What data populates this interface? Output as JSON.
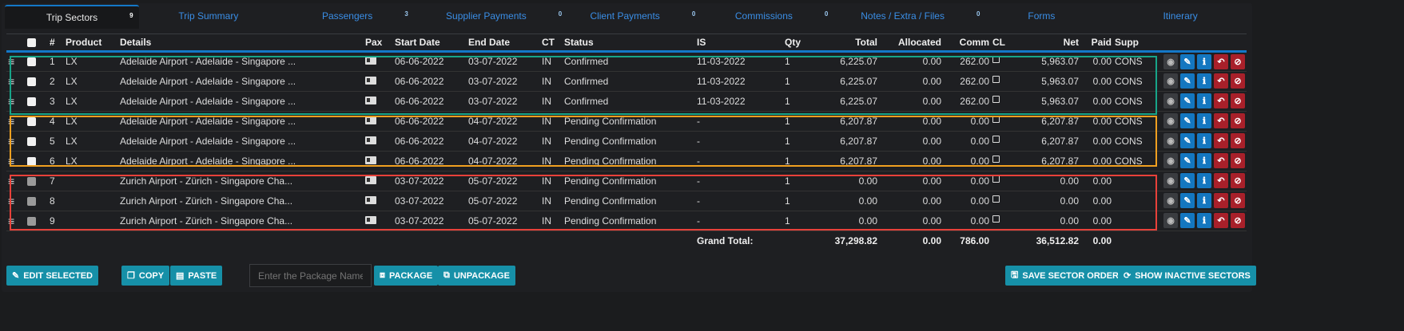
{
  "tabs": [
    {
      "label": "Trip Sectors",
      "count": "9",
      "active": true
    },
    {
      "label": "Trip Summary",
      "count": ""
    },
    {
      "label": "Passengers",
      "count": "3"
    },
    {
      "label": "Supplier Payments",
      "count": "0"
    },
    {
      "label": "Client Payments",
      "count": "0"
    },
    {
      "label": "Commissions",
      "count": "0"
    },
    {
      "label": "Notes / Extra / Files",
      "count": "0"
    },
    {
      "label": "Forms",
      "count": ""
    },
    {
      "label": "Itinerary",
      "count": ""
    }
  ],
  "columns": [
    "#",
    "Product",
    "Details",
    "Pax",
    "Start Date",
    "End Date",
    "CT",
    "Status",
    "IS",
    "Qty",
    "Total",
    "Allocated",
    "Comm",
    "CL",
    "Net",
    "Paid",
    "Supp"
  ],
  "rows": [
    {
      "n": "1",
      "product": "LX",
      "details": "Adelaide Airport - Adelaide - Singapore ...",
      "start": "06-06-2022",
      "end": "03-07-2022",
      "ct": "IN",
      "status": "Confirmed",
      "is": "11-03-2022",
      "qty": "1",
      "total": "6,225.07",
      "allocated": "0.00",
      "comm": "262.00",
      "net": "5,963.07",
      "paid": "0.00",
      "supp": "CONS"
    },
    {
      "n": "2",
      "product": "LX",
      "details": "Adelaide Airport - Adelaide - Singapore ...",
      "start": "06-06-2022",
      "end": "03-07-2022",
      "ct": "IN",
      "status": "Confirmed",
      "is": "11-03-2022",
      "qty": "1",
      "total": "6,225.07",
      "allocated": "0.00",
      "comm": "262.00",
      "net": "5,963.07",
      "paid": "0.00",
      "supp": "CONS"
    },
    {
      "n": "3",
      "product": "LX",
      "details": "Adelaide Airport - Adelaide - Singapore ...",
      "start": "06-06-2022",
      "end": "03-07-2022",
      "ct": "IN",
      "status": "Confirmed",
      "is": "11-03-2022",
      "qty": "1",
      "total": "6,225.07",
      "allocated": "0.00",
      "comm": "262.00",
      "net": "5,963.07",
      "paid": "0.00",
      "supp": "CONS"
    },
    {
      "n": "4",
      "product": "LX",
      "details": "Adelaide Airport - Adelaide - Singapore ...",
      "start": "06-06-2022",
      "end": "04-07-2022",
      "ct": "IN",
      "status": "Pending Confirmation",
      "is": "-",
      "qty": "1",
      "total": "6,207.87",
      "allocated": "0.00",
      "comm": "0.00",
      "net": "6,207.87",
      "paid": "0.00",
      "supp": "CONS"
    },
    {
      "n": "5",
      "product": "LX",
      "details": "Adelaide Airport - Adelaide - Singapore ...",
      "start": "06-06-2022",
      "end": "04-07-2022",
      "ct": "IN",
      "status": "Pending Confirmation",
      "is": "-",
      "qty": "1",
      "total": "6,207.87",
      "allocated": "0.00",
      "comm": "0.00",
      "net": "6,207.87",
      "paid": "0.00",
      "supp": "CONS"
    },
    {
      "n": "6",
      "product": "LX",
      "details": "Adelaide Airport - Adelaide - Singapore ...",
      "start": "06-06-2022",
      "end": "04-07-2022",
      "ct": "IN",
      "status": "Pending Confirmation",
      "is": "-",
      "qty": "1",
      "total": "6,207.87",
      "allocated": "0.00",
      "comm": "0.00",
      "net": "6,207.87",
      "paid": "0.00",
      "supp": "CONS"
    },
    {
      "n": "7",
      "product": "",
      "details": "Zurich Airport - Zürich - Singapore Cha...",
      "start": "03-07-2022",
      "end": "05-07-2022",
      "ct": "IN",
      "status": "Pending Confirmation",
      "is": "-",
      "qty": "1",
      "total": "0.00",
      "allocated": "0.00",
      "comm": "0.00",
      "net": "0.00",
      "paid": "0.00",
      "supp": "",
      "disabled": true
    },
    {
      "n": "8",
      "product": "",
      "details": "Zurich Airport - Zürich - Singapore Cha...",
      "start": "03-07-2022",
      "end": "05-07-2022",
      "ct": "IN",
      "status": "Pending Confirmation",
      "is": "-",
      "qty": "1",
      "total": "0.00",
      "allocated": "0.00",
      "comm": "0.00",
      "net": "0.00",
      "paid": "0.00",
      "supp": "",
      "disabled": true
    },
    {
      "n": "9",
      "product": "",
      "details": "Zurich Airport - Zürich - Singapore Cha...",
      "start": "03-07-2022",
      "end": "05-07-2022",
      "ct": "IN",
      "status": "Pending Confirmation",
      "is": "-",
      "qty": "1",
      "total": "0.00",
      "allocated": "0.00",
      "comm": "0.00",
      "net": "0.00",
      "paid": "0.00",
      "supp": "",
      "disabled": true
    }
  ],
  "grand_total": {
    "label": "Grand Total:",
    "total": "37,298.82",
    "allocated": "0.00",
    "comm": "786.00",
    "net": "36,512.82",
    "paid": "0.00"
  },
  "group_colors": [
    "#17a589",
    "#f0a020",
    "#e8413a"
  ],
  "buttons": {
    "edit_selected": "EDIT SELECTED",
    "copy": "COPY",
    "paste": "PASTE",
    "package": "PACKAGE",
    "unpackage": "UNPACKAGE",
    "save_order": "SAVE SECTOR ORDER",
    "show_inactive": "SHOW INACTIVE SECTORS"
  },
  "package_input": {
    "placeholder": "Enter the Package Name"
  }
}
